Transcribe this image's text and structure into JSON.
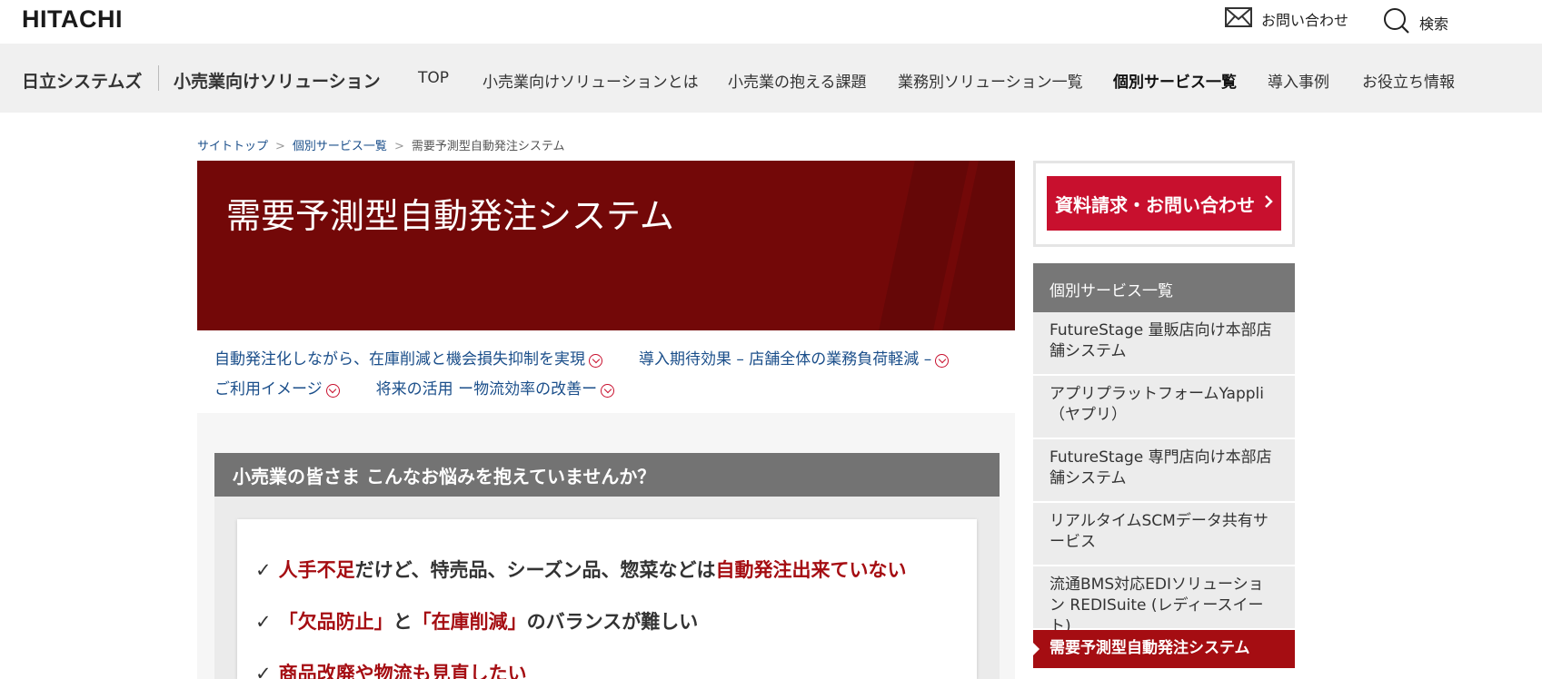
{
  "header": {
    "logo": "HITACHI",
    "contact_label": "お問い合わせ",
    "search_label": "検索"
  },
  "nav": {
    "brand": "日立システムズ",
    "brand_sub": "小売業向けソリューション",
    "items": [
      {
        "label": "TOP"
      },
      {
        "label": "小売業向けソリューションとは"
      },
      {
        "label": "小売業の抱える課題"
      },
      {
        "label": "業務別ソリューション一覧"
      },
      {
        "label": "個別サービス一覧",
        "active": true
      },
      {
        "label": "導入事例"
      },
      {
        "label": "お役立ち情報"
      }
    ]
  },
  "breadcrumb": {
    "items": [
      "サイトトップ",
      "個別サービス一覧",
      "需要予測型自動発注システム"
    ],
    "separator": ">"
  },
  "hero": {
    "title": "需要予測型自動発注システム"
  },
  "anchors": [
    "自動発注化しながら、在庫削減と機会損失抑制を実現",
    "導入期待効果 – 店舗全体の業務負荷軽減 –",
    "ご利用イメージ",
    "将来の活用 ー物流効率の改善ー"
  ],
  "problems": {
    "heading": "小売業の皆さま こんなお悩みを抱えていませんか？",
    "check_mark": "✓",
    "item1": {
      "a": "人手不足",
      "b": "だけど、特売品、シーズン品、惣菜などは",
      "c": "自動発注出来ていない"
    },
    "item2": {
      "a": "「欠品防止」",
      "b": "と",
      "c": "「在庫削減」",
      "d": "のバランスが難しい"
    },
    "item3": {
      "a": "商品改廃や物流も見直したい"
    }
  },
  "sidebar": {
    "cta_label": "資料請求・お問い合わせ",
    "heading": "個別サービス一覧",
    "items": [
      "FutureStage 量販店向け本部店舗システム",
      "アプリプラットフォームYappli（ヤプリ）",
      "FutureStage 専門店向け本部店舗システム",
      "リアルタイムSCMデータ共有サービス",
      "流通BMS対応EDIソリューション REDISuite (レディースイート)",
      "需要予測型自動発注システム"
    ]
  },
  "colors": {
    "brand_red": "#c8102e",
    "hero_bg": "#730808",
    "accent_text_red": "#a50d12",
    "link_blue": "#1a4e8a"
  }
}
